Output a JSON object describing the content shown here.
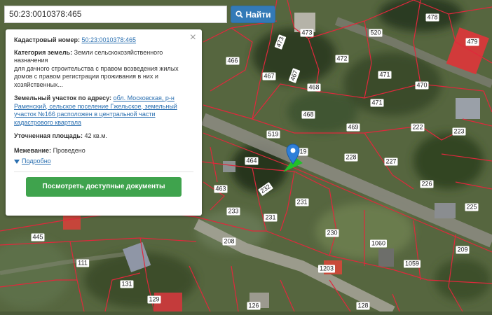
{
  "search": {
    "value": "50:23:0010378:465",
    "button_label": "Найти"
  },
  "popup": {
    "cadastral_label": "Кадастровый номер:",
    "cadastral_value": "50:23:0010378:465",
    "category_label": "Категория земель:",
    "category_value": "Земли сельскохозяйственного назначения",
    "category_desc": "для дачного строительства с правом возведения жилых домов с правом регистрации проживания в них и хозяйственных...",
    "address_label": "Земельный участок по адресу:",
    "address_value": "обл. Московская, р-н Раменский, сельское поселение Гжельское, земельный участок №166 расположен в центральной части кадастрового квартала",
    "area_label": "Уточненная площадь:",
    "area_value": "42 кв.м.",
    "survey_label": "Межевание:",
    "survey_value": "Проведено",
    "more_label": "Подробно",
    "docs_button": "Посмотреть доступные документы",
    "close_symbol": "×"
  },
  "plots": [
    "478",
    "473",
    "520",
    "479",
    "473",
    "466",
    "472",
    "471",
    "470",
    "467",
    "467",
    "468",
    "471",
    "222",
    "223",
    "468",
    "469",
    "519",
    "519",
    "228",
    "227",
    "464",
    "232",
    "463",
    "226",
    "231",
    "233",
    "225",
    "231",
    "230",
    "208",
    "1060",
    "209",
    "445",
    "111",
    "1059",
    "1203",
    "131",
    "129",
    "126",
    "128"
  ],
  "colors": {
    "boundary": "#e0283c",
    "search_button": "#337ab7",
    "docs_button": "#3fa34d",
    "marker": "#2f7fd8",
    "arrow": "#22c02a"
  }
}
